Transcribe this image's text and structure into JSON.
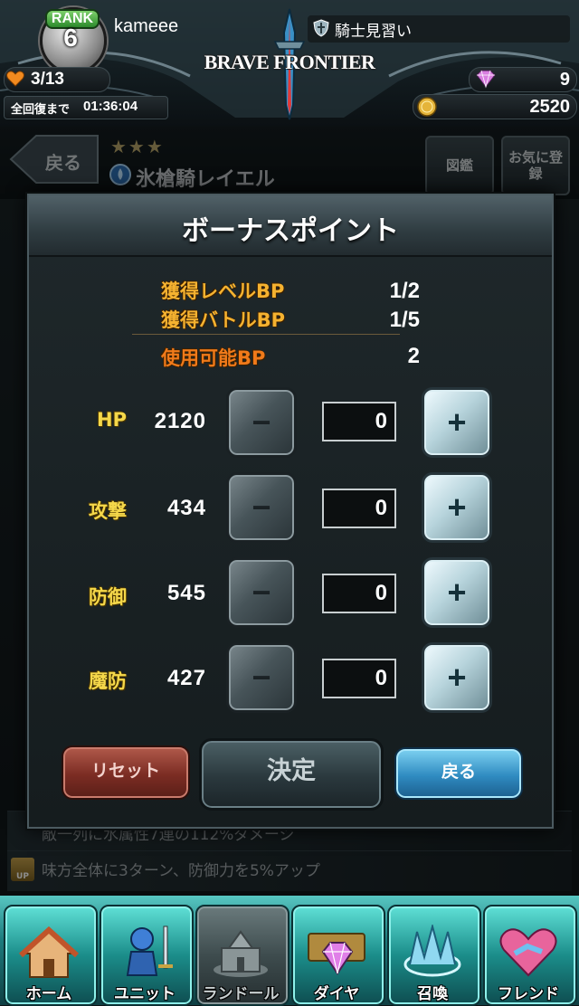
{
  "header": {
    "rank_label": "RANK",
    "rank_value": "6",
    "player_name": "kameee",
    "title": "騎士見習い",
    "logo": "BRAVE FRONTIER",
    "energy": "3/13",
    "recovery_label": "全回復まで",
    "recovery_time": "01:36:04",
    "gems": "9",
    "zel": "2520"
  },
  "background": {
    "back_label": "戻る",
    "stars": "★★★",
    "unit_name": "氷槍騎レイエル",
    "guide_button": "図鑑",
    "favorite_button": "お気に登録",
    "skill_line_1": "敵一列に水属性7連の112%ダメージ",
    "skill_line_2": "味方全体に3ターン、防御力を5%アップ",
    "up_icon_text": "UP"
  },
  "modal": {
    "title": "ボーナスポイント",
    "level_bp_label": "獲得レベルBP",
    "level_bp_value": "1/2",
    "battle_bp_label": "獲得バトルBP",
    "battle_bp_value": "1/5",
    "usable_bp_label": "使用可能BP",
    "usable_bp_value": "2",
    "stats": [
      {
        "label": "HP",
        "value": "2120",
        "count": "0"
      },
      {
        "label": "攻撃",
        "value": "434",
        "count": "0"
      },
      {
        "label": "防御",
        "value": "545",
        "count": "0"
      },
      {
        "label": "魔防",
        "value": "427",
        "count": "0"
      }
    ],
    "minus_symbol": "−",
    "plus_symbol": "+",
    "reset_label": "リセット",
    "confirm_label": "決定",
    "back_label": "戻る"
  },
  "footer": {
    "items": [
      {
        "label": "ホーム",
        "icon": "home-icon"
      },
      {
        "label": "ユニット",
        "icon": "unit-icon"
      },
      {
        "label": "ランドール",
        "icon": "castle-icon"
      },
      {
        "label": "ダイヤ",
        "icon": "diamond-icon"
      },
      {
        "label": "召喚",
        "icon": "summon-icon"
      },
      {
        "label": "フレンド",
        "icon": "friend-icon"
      }
    ]
  },
  "colors": {
    "bp_orange": "#f0a020",
    "stat_yellow": "#f5d84a",
    "accent_teal": "#1d7c7e"
  }
}
